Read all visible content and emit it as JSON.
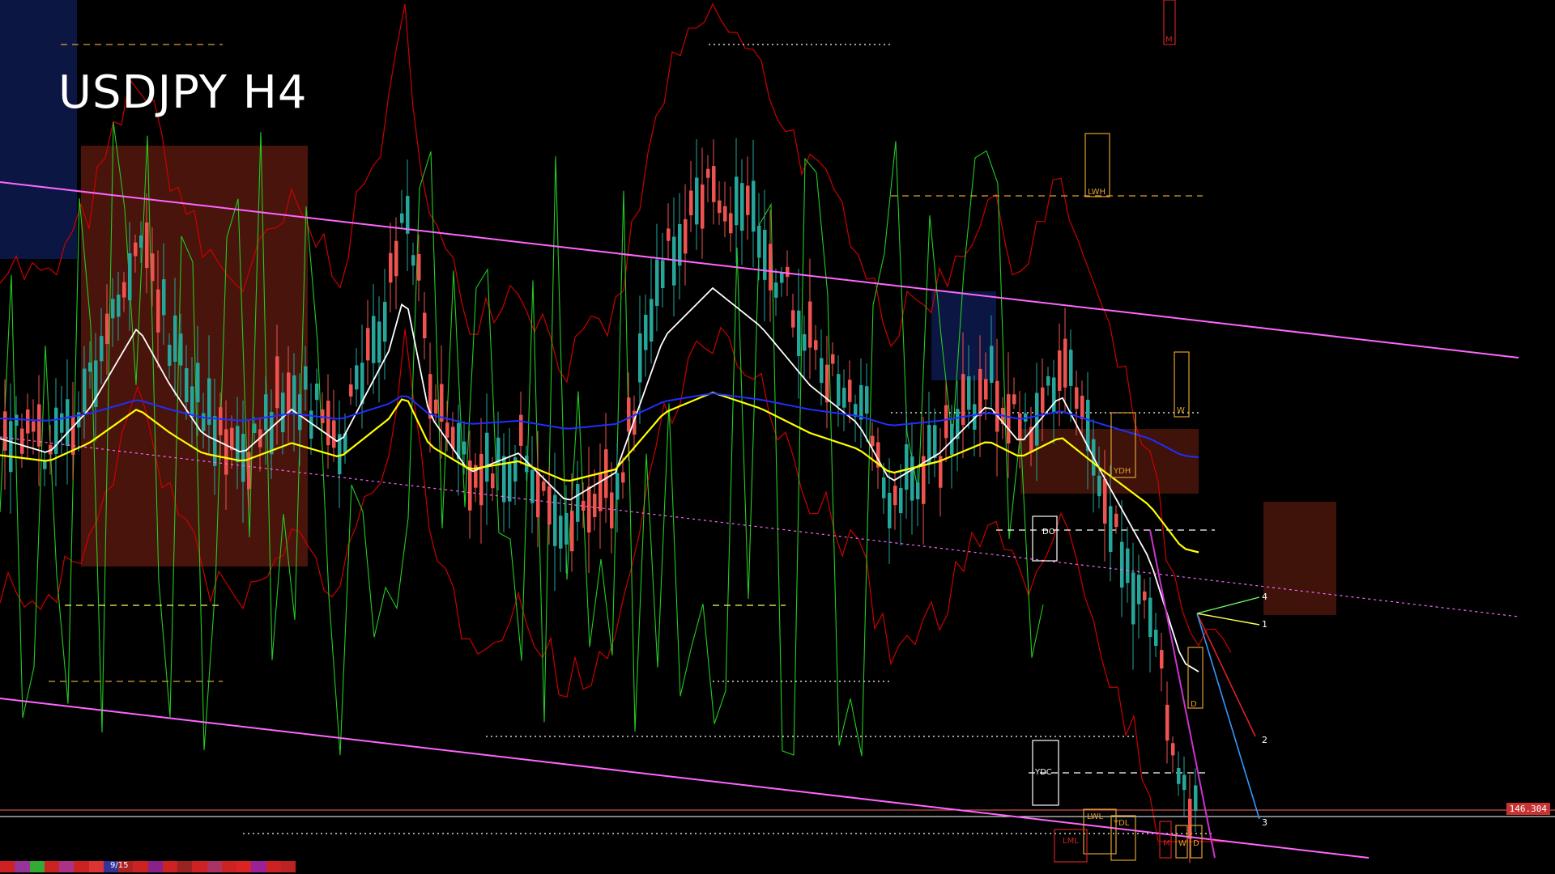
{
  "header": {
    "title": "USDJPY H4"
  },
  "status": {
    "current_price": "146.304",
    "page_indicator": "9/15"
  },
  "colors": {
    "background": "#000000",
    "bull": "#26a69a",
    "bear": "#ef5350",
    "channel": "#ff66ff",
    "ma_fast": "#ffffff",
    "ma_mid": "#ffff00",
    "ma_slow": "#1f2fff",
    "bands": "#cc0000",
    "oscillator": "#22cc22",
    "cloud_bear": "#d03a20",
    "cloud_bull": "#2040c0",
    "levels": "#e0a030"
  },
  "chart_data": {
    "type": "candlestick",
    "title": "USDJPY H4",
    "level_labels": [
      "LWH",
      "W",
      "YDH",
      "DO",
      "D",
      "YDC",
      "LWL",
      "YDL",
      "LML",
      "M",
      "W",
      "D",
      "M"
    ],
    "projection_labels": [
      "4",
      "1",
      "2",
      "3"
    ],
    "current_price": 146.304,
    "grid": false
  }
}
